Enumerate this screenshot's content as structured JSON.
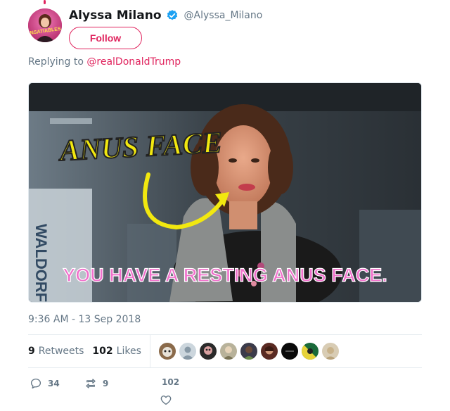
{
  "tweet": {
    "display_name": "Alyssa Milano",
    "handle": "@Alyssa_Milano",
    "avatar_text": "INSATIABLES",
    "follow_label": "Follow",
    "replying_prefix": "Replying to",
    "replying_to": "@realDonaldTrump",
    "media": {
      "caption_top": "ANUS FACE",
      "caption_bottom": "YOU HAVE A RESTING ANUS FACE.",
      "background_sign": "WALDORF"
    },
    "timestamp": "9:36 AM - 13 Sep 2018",
    "stats": {
      "retweets_count": "9",
      "retweets_label": "Retweets",
      "likes_count": "102",
      "likes_label": "Likes"
    },
    "liker_avatars": [
      "avatar-1",
      "avatar-2",
      "avatar-3",
      "avatar-4",
      "avatar-5",
      "avatar-6",
      "avatar-7",
      "avatar-8",
      "avatar-9"
    ],
    "actions": {
      "replies": "34",
      "retweets": "9",
      "likes": "102"
    }
  },
  "colors": {
    "accent": "#e0245e",
    "verified": "#1da1f2",
    "muted": "#657786",
    "caption_yellow": "#f2e80f",
    "caption_pink": "#f06fcb"
  },
  "icons": [
    "verified-badge-icon",
    "reply-icon",
    "retweet-icon",
    "heart-icon"
  ]
}
